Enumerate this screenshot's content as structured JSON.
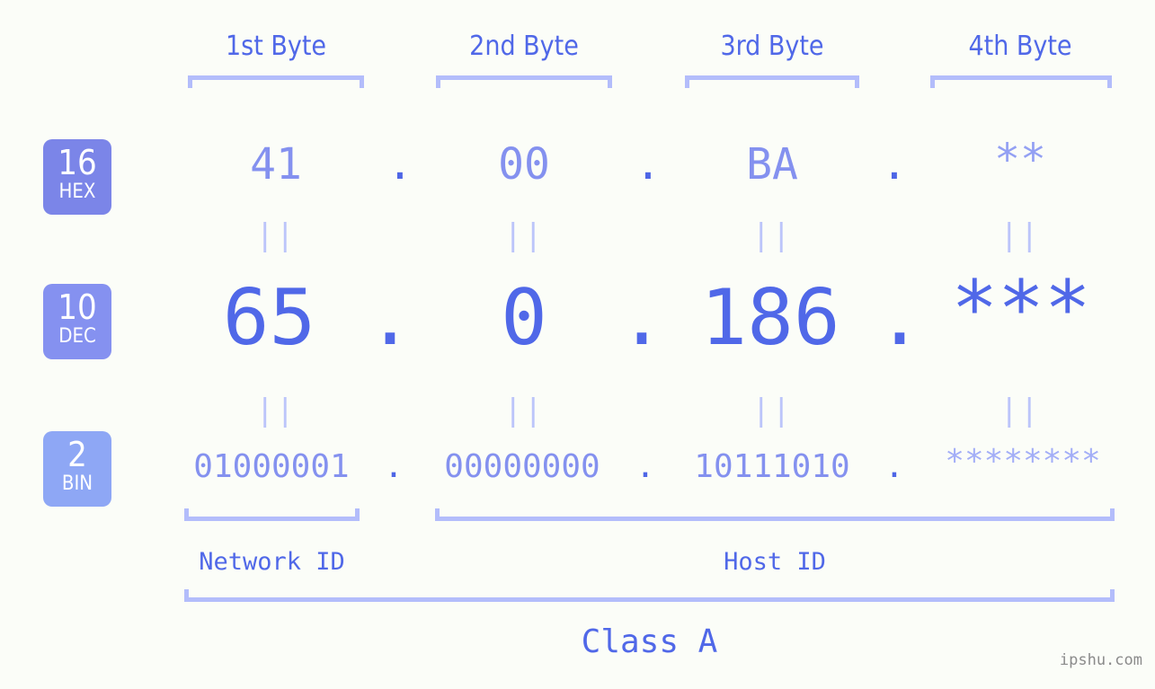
{
  "background_color": "#fbfdf8",
  "accent_color": "#5068e8",
  "accent_light_color": "#8491ef",
  "bracket_color": "#b3bdfb",
  "byte_headers": [
    {
      "label": "1st Byte"
    },
    {
      "label": "2nd Byte"
    },
    {
      "label": "3rd Byte"
    },
    {
      "label": "4th Byte"
    }
  ],
  "bases": [
    {
      "number": "16",
      "name": "HEX",
      "color": "#7b85e8"
    },
    {
      "number": "10",
      "name": "DEC",
      "color": "#8591f0"
    },
    {
      "number": "2",
      "name": "BIN",
      "color": "#8ea7f5"
    }
  ],
  "rows": {
    "hex": {
      "base_number": "16",
      "base_name": "HEX",
      "values": [
        "41",
        "00",
        "BA",
        "**"
      ],
      "separator": "."
    },
    "dec": {
      "base_number": "10",
      "base_name": "DEC",
      "values": [
        "65",
        "0",
        "186",
        "***"
      ],
      "separator": "."
    },
    "bin": {
      "base_number": "2",
      "base_name": "BIN",
      "values": [
        "01000001",
        "00000000",
        "10111010",
        "********"
      ],
      "separator": "."
    }
  },
  "equality_marker": "||",
  "sections": [
    {
      "label": "Network ID"
    },
    {
      "label": "Host ID"
    }
  ],
  "class_label": "Class A",
  "watermark": "ipshu.com"
}
